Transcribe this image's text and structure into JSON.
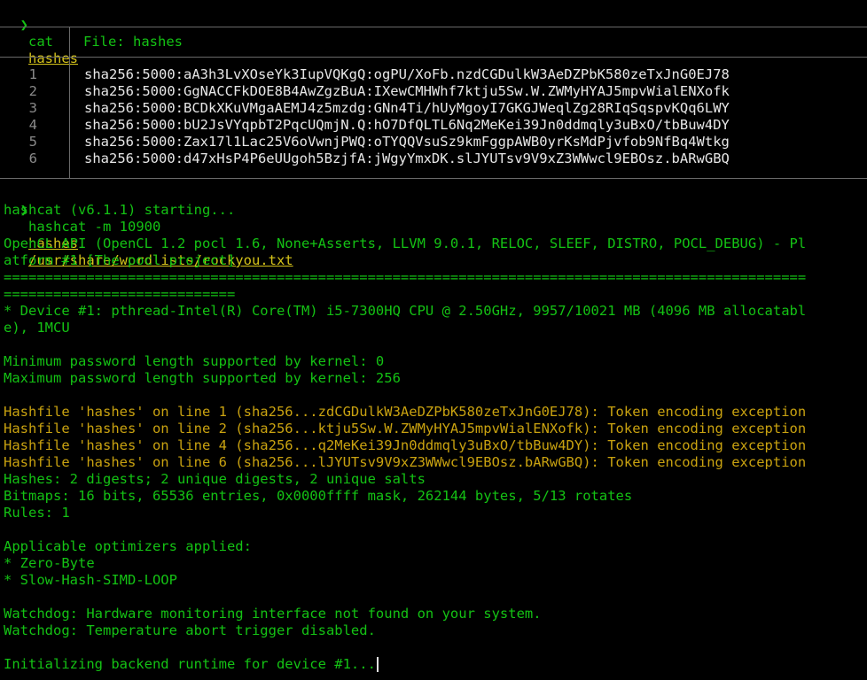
{
  "commands": {
    "cat": {
      "prompt": "❯",
      "command": "cat",
      "arg": "hashes"
    },
    "hashcat": {
      "prompt": "❯",
      "command": "hashcat -m 10900",
      "arg1": "hashes",
      "arg2": "/usr/share/wordlists/rockyou.txt"
    }
  },
  "file_view": {
    "header": "File: hashes",
    "lines": [
      {
        "num": "1",
        "text": "sha256:5000:aA3h3LvXOseYk3IupVQKgQ:ogPU/XoFb.nzdCGDulkW3AeDZPbK580zeTxJnG0EJ78"
      },
      {
        "num": "2",
        "text": "sha256:5000:GgNACCFkDOE8B4AwZgzBuA:IXewCMHWhf7ktju5Sw.W.ZWMyHYAJ5mpvWialENXofk"
      },
      {
        "num": "3",
        "text": "sha256:5000:BCDkXKuVMgaAEMJ4z5mzdg:GNn4Ti/hUyMgoyI7GKGJWeqlZg28RIqSqspvKQq6LWY"
      },
      {
        "num": "4",
        "text": "sha256:5000:bU2JsVYqpbT2PqcUQmjN.Q:hO7DfQLTL6Nq2MeKei39Jn0ddmqly3uBxO/tbBuw4DY"
      },
      {
        "num": "5",
        "text": "sha256:5000:Zax17l1Lac25V6oVwnjPWQ:oTYQQVsuSz9kmFggpAWB0yrKsMdPjvfob9NfBq4Wtkg"
      },
      {
        "num": "6",
        "text": "sha256:5000:d47xHsP4P6eUUgoh5BzjfA:jWgyYmxDK.slJYUTsv9V9xZ3WWwcl9EBOsz.bARwGBQ"
      }
    ]
  },
  "output": [
    {
      "text": "hashcat (v6.1.1) starting...",
      "color": "green"
    },
    {
      "text": "",
      "color": "green"
    },
    {
      "text": "OpenCL API (OpenCL 1.2 pocl 1.6, None+Asserts, LLVM 9.0.1, RELOC, SLEEF, DISTRO, POCL_DEBUG) - Pl",
      "color": "green"
    },
    {
      "text": "atform #1 [The pocl project]",
      "color": "green"
    },
    {
      "text": "=================================================================================================",
      "color": "green"
    },
    {
      "text": "============================",
      "color": "green"
    },
    {
      "text": "* Device #1: pthread-Intel(R) Core(TM) i5-7300HQ CPU @ 2.50GHz, 9957/10021 MB (4096 MB allocatabl",
      "color": "green"
    },
    {
      "text": "e), 1MCU",
      "color": "green"
    },
    {
      "text": "",
      "color": "green"
    },
    {
      "text": "Minimum password length supported by kernel: 0",
      "color": "green"
    },
    {
      "text": "Maximum password length supported by kernel: 256",
      "color": "green"
    },
    {
      "text": "",
      "color": "green"
    },
    {
      "text": "Hashfile 'hashes' on line 1 (sha256...zdCGDulkW3AeDZPbK580zeTxJnG0EJ78): Token encoding exception",
      "color": "orange"
    },
    {
      "text": "Hashfile 'hashes' on line 2 (sha256...ktju5Sw.W.ZWMyHYAJ5mpvWialENXofk): Token encoding exception",
      "color": "orange"
    },
    {
      "text": "Hashfile 'hashes' on line 4 (sha256...q2MeKei39Jn0ddmqly3uBxO/tbBuw4DY): Token encoding exception",
      "color": "orange"
    },
    {
      "text": "Hashfile 'hashes' on line 6 (sha256...lJYUTsv9V9xZ3WWwcl9EBOsz.bARwGBQ): Token encoding exception",
      "color": "orange"
    },
    {
      "text": "Hashes: 2 digests; 2 unique digests, 2 unique salts",
      "color": "green"
    },
    {
      "text": "Bitmaps: 16 bits, 65536 entries, 0x0000ffff mask, 262144 bytes, 5/13 rotates",
      "color": "green"
    },
    {
      "text": "Rules: 1",
      "color": "green"
    },
    {
      "text": "",
      "color": "green"
    },
    {
      "text": "Applicable optimizers applied:",
      "color": "green"
    },
    {
      "text": "* Zero-Byte",
      "color": "green"
    },
    {
      "text": "* Slow-Hash-SIMD-LOOP",
      "color": "green"
    },
    {
      "text": "",
      "color": "green"
    },
    {
      "text": "Watchdog: Hardware monitoring interface not found on your system.",
      "color": "green"
    },
    {
      "text": "Watchdog: Temperature abort trigger disabled.",
      "color": "green"
    },
    {
      "text": "",
      "color": "green"
    },
    {
      "text": "Initializing backend runtime for device #1...",
      "color": "green"
    }
  ],
  "colors": {
    "green": "#14c214",
    "orange": "#c9a210",
    "argument_yellow": "#d4c21a",
    "background": "#000000"
  }
}
